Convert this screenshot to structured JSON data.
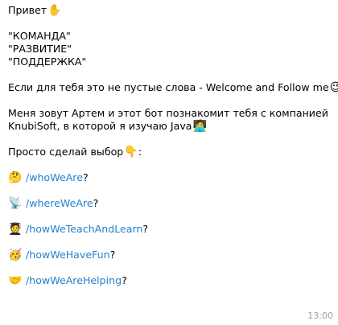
{
  "message": {
    "greeting": "Привет",
    "greeting_emoji": "✋",
    "values": [
      "\"КОМАНДА\"",
      "\"РАЗВИТИЕ\"",
      "\"ПОДДЕРЖКА\""
    ],
    "welcome_line": "Если для тебя это не пустые слова - Welcome and Follow me",
    "welcome_emoji": "😉",
    "intro_line1": "Меня зовут Артем и этот бот познакомит тебя с компанией",
    "intro_line2": "KnubiSoft, в которой я изучаю Java",
    "intro_emoji": "🧑‍💻",
    "choice_line": "Просто сделай выбор",
    "choice_emoji": "👇",
    "choice_colon": ":",
    "commands": [
      {
        "emoji": "🤔",
        "command": "/whoWeAre",
        "suffix": "?"
      },
      {
        "emoji": "📡",
        "command": "/whereWeAre",
        "suffix": "?"
      },
      {
        "emoji": "🧑‍🎓",
        "command": "/howWeTeachAndLearn",
        "suffix": "?"
      },
      {
        "emoji": "🥳",
        "command": "/howWeHaveFun",
        "suffix": "?"
      },
      {
        "emoji": "🤝",
        "command": "/howWeAreHelping",
        "suffix": "?"
      }
    ],
    "time": "13:00"
  },
  "colors": {
    "link": "#2481cc",
    "time": "#a0a0a0"
  }
}
